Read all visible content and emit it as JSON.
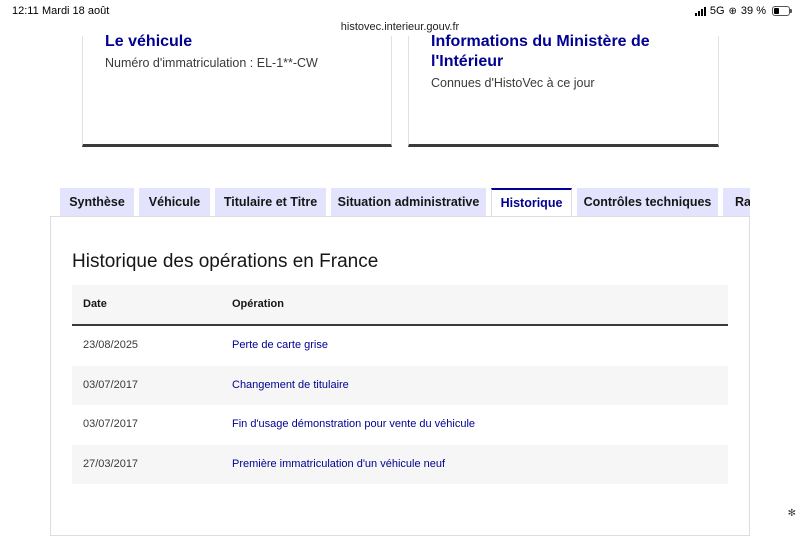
{
  "status_bar": {
    "time": "12:11",
    "date": "Mardi 18 août",
    "url": "histovec.interieur.gouv.fr",
    "network": "5G",
    "battery_text": "39 %",
    "battery_level_percent": 39
  },
  "cards": {
    "vehicle": {
      "title": "Le véhicule",
      "text": "Numéro d'immatriculation : EL-1**-CW"
    },
    "ministry": {
      "title": "Informations du Ministère de l'Intérieur",
      "text": "Connues d'HistoVec à ce jour"
    }
  },
  "tabs": [
    {
      "label": "Synthèse",
      "active": false
    },
    {
      "label": "Véhicule",
      "active": false
    },
    {
      "label": "Titulaire et Titre",
      "active": false
    },
    {
      "label": "Situation administrative",
      "active": false
    },
    {
      "label": "Historique",
      "active": true
    },
    {
      "label": "Contrôles techniques",
      "active": false
    },
    {
      "label": "Rap",
      "active": false
    }
  ],
  "history": {
    "title": "Historique des opérations en France",
    "columns": [
      "Date",
      "Opération"
    ],
    "rows": [
      {
        "date": "23/08/2025",
        "operation": "Perte de carte grise"
      },
      {
        "date": "03/07/2017",
        "operation": "Changement de titulaire"
      },
      {
        "date": "03/07/2017",
        "operation": "Fin d'usage démonstration pour vente du véhicule"
      },
      {
        "date": "27/03/2017",
        "operation": "Première immatriculation d'un véhicule neuf"
      }
    ]
  },
  "colors": {
    "brand_blue": "#000091",
    "tab_background": "#e3e3fd",
    "row_alt": "#f6f6f6"
  }
}
